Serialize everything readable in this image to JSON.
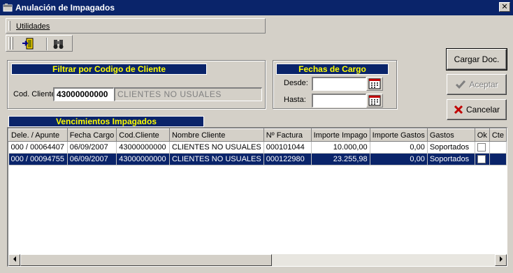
{
  "window": {
    "title": "Anulación de Impagados",
    "close_glyph": "✕"
  },
  "menu": {
    "utilidades": "Utilidades"
  },
  "toolbar": {
    "icons": [
      "exit-door-icon",
      "binoculars-icon"
    ]
  },
  "filter": {
    "header": "Filtrar por Codigo de Cliente",
    "cod_label": "Cod. Cliente",
    "cod_value": "43000000000",
    "client_name": "CLIENTES NO USUALES"
  },
  "dates": {
    "header": "Fechas de Cargo",
    "desde_label": "Desde:",
    "desde_value": "",
    "hasta_label": "Hasta:",
    "hasta_value": ""
  },
  "buttons": {
    "cargar": "Cargar Doc.",
    "aceptar": "Aceptar",
    "cancelar": "Cancelar"
  },
  "grid": {
    "caption": "Vencimientos Impagados",
    "columns": [
      "Dele. / Apunte",
      "Fecha Cargo",
      "Cod.Cliente",
      "Nombre Cliente",
      "Nº Factura",
      "Importe Impago",
      "Importe Gastos",
      "Gastos",
      "Ok",
      "Cte"
    ],
    "rows": [
      {
        "apunte": "000 / 00064407",
        "fecha": "06/09/2007",
        "cod": "43000000000",
        "nombre": "CLIENTES NO USUALES",
        "factura": "000101044",
        "impago": "10.000,00",
        "gastos_imp": "0,00",
        "gastos": "Soportados",
        "ok": false,
        "selected": false
      },
      {
        "apunte": "000 / 00094755",
        "fecha": "06/09/2007",
        "cod": "43000000000",
        "nombre": "CLIENTES NO USUALES",
        "factura": "000122980",
        "impago": "23.255,98",
        "gastos_imp": "0,00",
        "gastos": "Soportados",
        "ok": false,
        "selected": true
      }
    ]
  },
  "colors": {
    "header_bg": "#0a246a",
    "header_text": "#ffff00",
    "face": "#d4d0c8"
  }
}
